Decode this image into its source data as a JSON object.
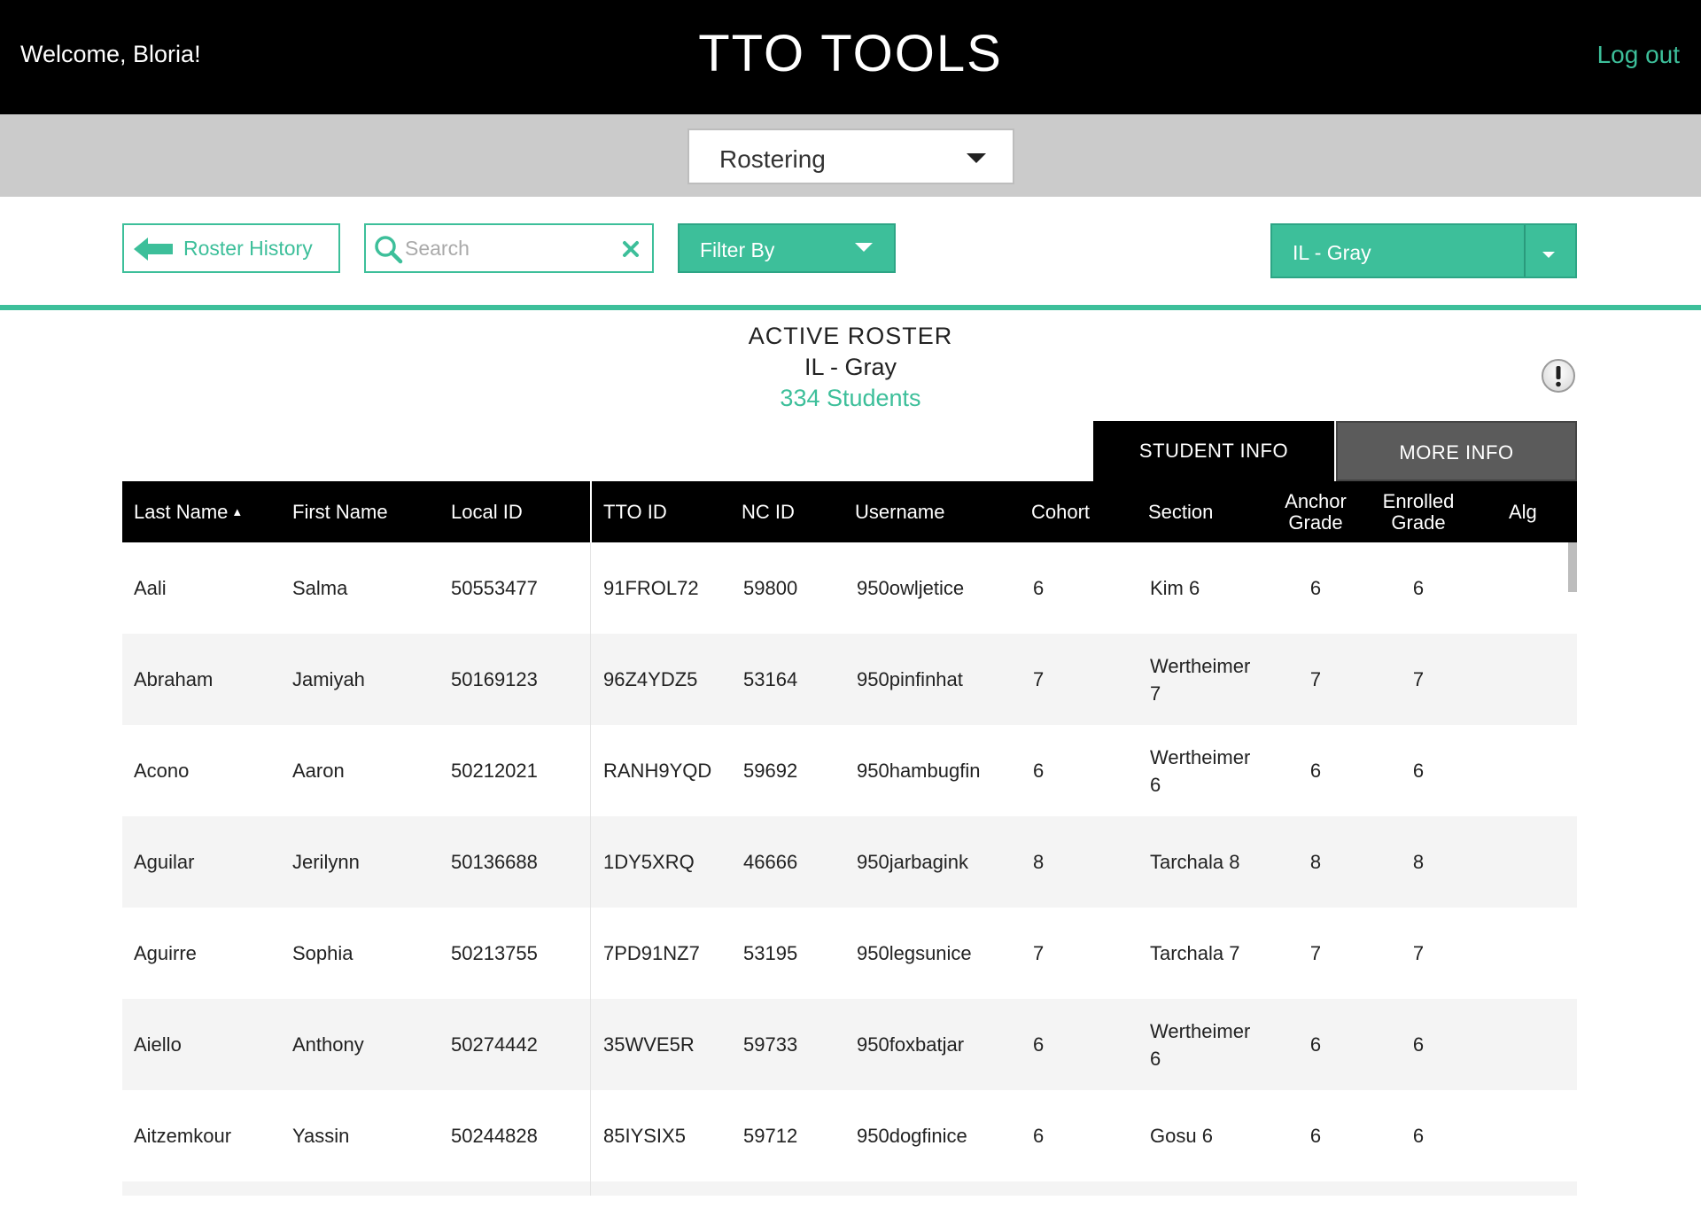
{
  "header": {
    "welcome": "Welcome, Bloria!",
    "brand": "TTO TOOLS",
    "logout": "Log out"
  },
  "module": {
    "selected": "Rostering"
  },
  "toolbar": {
    "roster_history": "Roster History",
    "search_placeholder": "Search",
    "search_value": "",
    "filter_by": "Filter By",
    "school": "IL - Gray"
  },
  "roster": {
    "title": "ACTIVE ROSTER",
    "school": "IL - Gray",
    "count": "334 Students"
  },
  "tabs": {
    "student_info": "STUDENT INFO",
    "more_info": "MORE INFO"
  },
  "table": {
    "columns": {
      "last_name": "Last Name",
      "first_name": "First Name",
      "local_id": "Local ID",
      "tto_id": "TTO ID",
      "nc_id": "NC ID",
      "username": "Username",
      "cohort": "Cohort",
      "section": "Section",
      "anchor_l1": "Anchor",
      "anchor_l2": "Grade",
      "enrolled_l1": "Enrolled",
      "enrolled_l2": "Grade",
      "alg": "Alg"
    },
    "rows": [
      {
        "last": "Aali",
        "first": "Salma",
        "local": "50553477",
        "tto": "91FROL72",
        "nc": "59800",
        "user": "950owljetice",
        "cohort": "6",
        "sec1": "Kim 6",
        "sec2": "",
        "anchor": "6",
        "enrolled": "6",
        "alg": ""
      },
      {
        "last": "Abraham",
        "first": "Jamiyah",
        "local": "50169123",
        "tto": "96Z4YDZ5",
        "nc": "53164",
        "user": "950pinfinhat",
        "cohort": "7",
        "sec1": "Wertheimer",
        "sec2": "7",
        "anchor": "7",
        "enrolled": "7",
        "alg": ""
      },
      {
        "last": "Acono",
        "first": "Aaron",
        "local": "50212021",
        "tto": "RANH9YQD",
        "nc": "59692",
        "user": "950hambugfin",
        "cohort": "6",
        "sec1": "Wertheimer",
        "sec2": "6",
        "anchor": "6",
        "enrolled": "6",
        "alg": ""
      },
      {
        "last": "Aguilar",
        "first": "Jerilynn",
        "local": "50136688",
        "tto": "1DY5XRQ",
        "nc": "46666",
        "user": "950jarbagink",
        "cohort": "8",
        "sec1": "Tarchala 8",
        "sec2": "",
        "anchor": "8",
        "enrolled": "8",
        "alg": ""
      },
      {
        "last": "Aguirre",
        "first": "Sophia",
        "local": "50213755",
        "tto": "7PD91NZ7",
        "nc": "53195",
        "user": "950legsunice",
        "cohort": "7",
        "sec1": "Tarchala 7",
        "sec2": "",
        "anchor": "7",
        "enrolled": "7",
        "alg": ""
      },
      {
        "last": "Aiello",
        "first": "Anthony",
        "local": "50274442",
        "tto": "35WVE5R",
        "nc": "59733",
        "user": "950foxbatjar",
        "cohort": "6",
        "sec1": "Wertheimer",
        "sec2": "6",
        "anchor": "6",
        "enrolled": "6",
        "alg": ""
      },
      {
        "last": "Aitzemkour",
        "first": "Yassin",
        "local": "50244828",
        "tto": "85IYSIX5",
        "nc": "59712",
        "user": "950dogfinice",
        "cohort": "6",
        "sec1": "Gosu 6",
        "sec2": "",
        "anchor": "6",
        "enrolled": "6",
        "alg": ""
      },
      {
        "last": "",
        "first": "",
        "local": "",
        "tto": "",
        "nc": "",
        "user": "",
        "cohort": "",
        "sec1": "",
        "sec2": "",
        "anchor": "",
        "enrolled": "",
        "alg": ""
      }
    ]
  },
  "colors": {
    "accent": "#3dbf9a",
    "header_bg": "#000000",
    "module_bar_bg": "#cbcbcb",
    "row_alt": "#f4f4f4"
  }
}
